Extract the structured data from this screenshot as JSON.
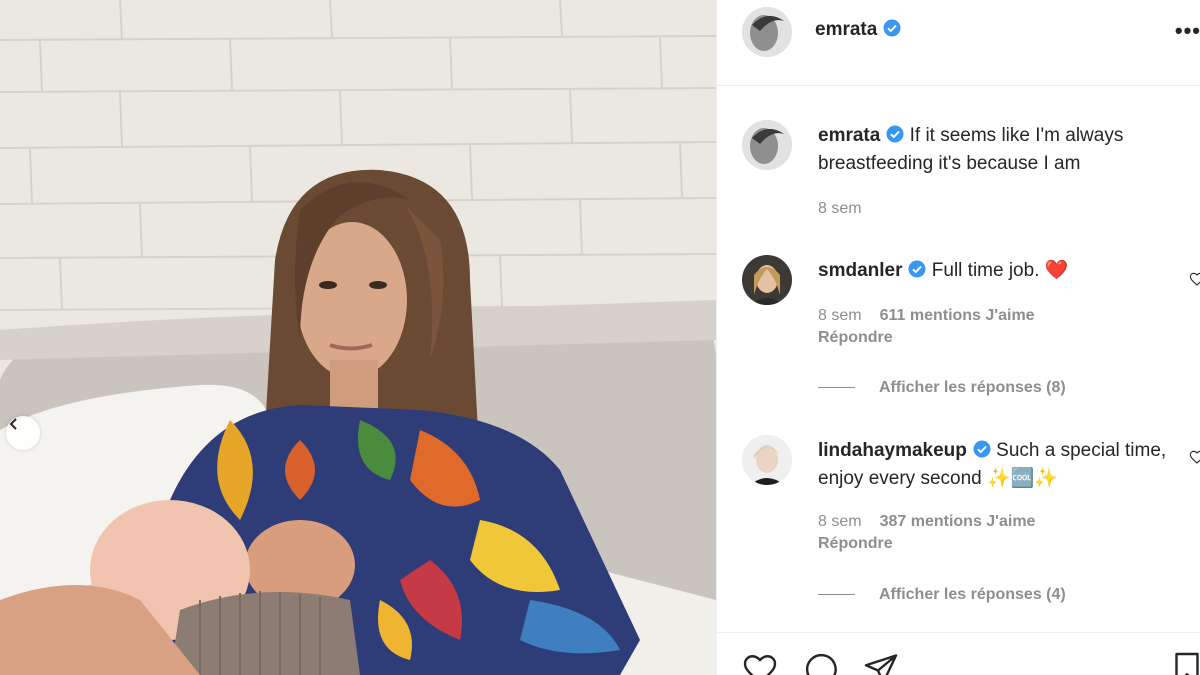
{
  "post": {
    "username": "emrata",
    "more_label": "•••"
  },
  "caption": {
    "username": "emrata",
    "text": "If it seems like I'm always breastfeeding it's because I am",
    "time": "8 sem"
  },
  "comments": [
    {
      "username": "smdanler",
      "text": "Full time job. ❤️",
      "time": "8 sem",
      "likes": "611 mentions J'aime",
      "reply_label": "Répondre",
      "view_replies": "Afficher les réponses (8)"
    },
    {
      "username": "lindahaymakeup",
      "text": "Such a special time, enjoy every second ✨🆒✨",
      "time": "8 sem",
      "likes": "387 mentions J'aime",
      "reply_label": "Répondre",
      "view_replies": "Afficher les réponses (4)"
    }
  ],
  "icons": {
    "verified": "verified-badge-icon",
    "heart": "heart-icon",
    "comment": "comment-icon",
    "share": "share-icon",
    "save": "bookmark-icon",
    "prev": "chevron-left-icon"
  },
  "colors": {
    "verified_blue": "#3897f0",
    "text": "#262626",
    "muted": "#8e8e8e",
    "divider": "#efefef"
  }
}
